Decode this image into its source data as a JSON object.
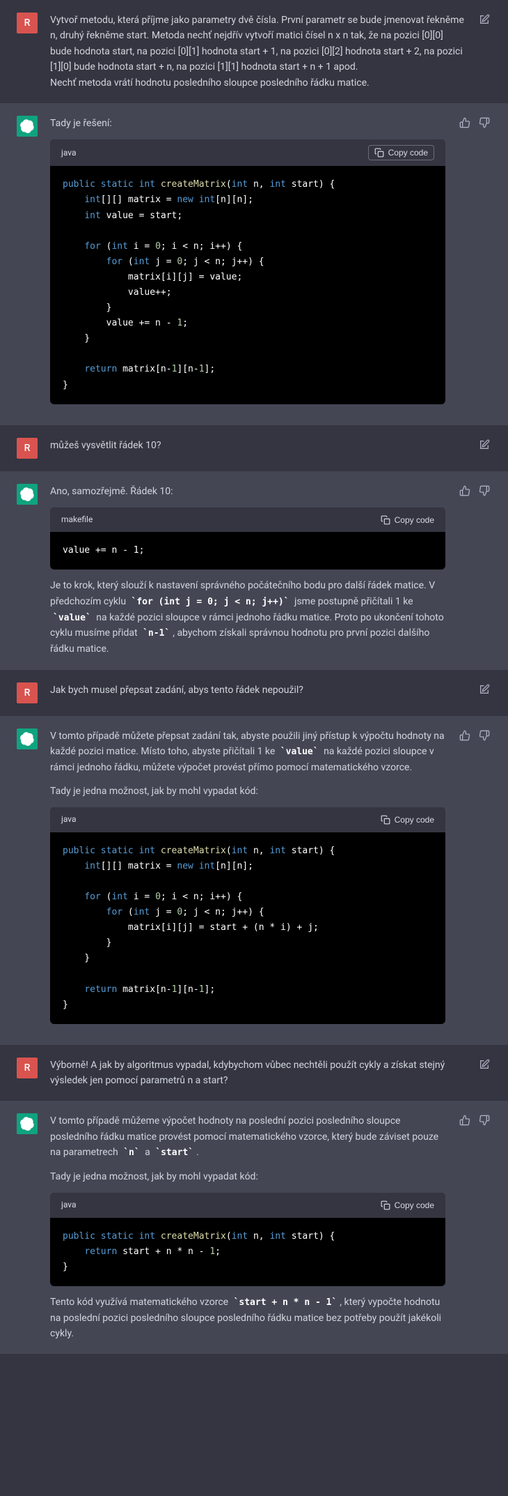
{
  "messages": [
    {
      "role": "user",
      "avatar": "R",
      "text": "Vytvoř metodu, která příjme jako parametry dvě čísla. První parametr se bude jmenovat řekněme n, druhý řekněme start. Metoda nechť nejdřív vytvoří matici čísel n x n tak, že na pozici [0][0] bude hodnota start, na pozici [0][1] hodnota start + 1, na pozici [0][2] hodnota start + 2, na pozici [1][0] bude hodnota start + n, na pozici [1][1] hodnota start + n + 1 apod.\nNechť metoda vrátí hodnotu posledního sloupce posledního řádku matice.",
      "actions": [
        "edit"
      ]
    },
    {
      "role": "assistant",
      "intro": "Tady je řešení:",
      "actions": [
        "thumbs-up",
        "thumbs-down"
      ],
      "code": {
        "lang": "java",
        "copy_label": "Copy code",
        "boxed_copy": true
      }
    },
    {
      "role": "user",
      "avatar": "R",
      "text": "můžeš vysvětlit řádek 10?",
      "actions": [
        "edit"
      ]
    },
    {
      "role": "assistant",
      "intro": "Ano, samozřejmě. Řádek 10:",
      "actions": [
        "thumbs-up",
        "thumbs-down"
      ],
      "code": {
        "lang": "makefile",
        "copy_label": "Copy code",
        "boxed_copy": false,
        "line": "value += n - 1;"
      },
      "explanation": {
        "pre1": "Je to krok, který slouží k nastavení správného počátečního bodu pro další řádek matice. V předchozím cyklu ",
        "c1": "for (int j = 0; j < n; j++)",
        "mid1": " jsme postupně přičítali 1 ke ",
        "c2": "value",
        "mid2": " na každé pozici sloupce v rámci jednoho řádku matice. Proto po ukončení tohoto cyklu musíme přidat ",
        "c3": "n-1",
        "post1": ", abychom získali správnou hodnotu pro první pozici dalšího řádku matice."
      }
    },
    {
      "role": "user",
      "avatar": "R",
      "text": "Jak bych musel přepsat zadání, abys tento řádek nepoužil?",
      "actions": [
        "edit"
      ]
    },
    {
      "role": "assistant",
      "intro_parts": {
        "pre": "V tomto případě můžete přepsat zadání tak, abyste použili jiný přístup k výpočtu hodnoty na každé pozici matice. Místo toho, abyste přičítali 1 ke ",
        "c1": "value",
        "post": " na každé pozici sloupce v rámci jednoho řádku, můžete výpočet provést přímo pomocí matematického vzorce."
      },
      "intro2": "Tady je jedna možnost, jak by mohl vypadat kód:",
      "actions": [
        "thumbs-up",
        "thumbs-down"
      ],
      "code": {
        "lang": "java",
        "copy_label": "Copy code",
        "boxed_copy": false
      }
    },
    {
      "role": "user",
      "avatar": "R",
      "text": "Výborně! A jak by algoritmus vypadal, kdybychom vůbec nechtěli použít cykly a získat stejný výsledek jen pomocí parametrů n a start?",
      "actions": [
        "edit"
      ]
    },
    {
      "role": "assistant",
      "intro_parts": {
        "pre": "V tomto případě můžeme výpočet hodnoty na poslední pozici posledního sloupce posledního řádku matice provést pomocí matematického vzorce, který bude záviset pouze na parametrech ",
        "c1": "n",
        "mid": " a ",
        "c2": "start",
        "post": "."
      },
      "intro2": "Tady je jedna možnost, jak by mohl vypadat kód:",
      "actions": [
        "thumbs-up",
        "thumbs-down"
      ],
      "code": {
        "lang": "java",
        "copy_label": "Copy code",
        "boxed_copy": false
      },
      "outro_parts": {
        "pre": "Tento kód využívá matematického vzorce ",
        "c1": "start + n * n - 1",
        "post": ", který vypočte hodnotu na poslední pozici posledního sloupce posledního řádku matice bez potřeby použít jakékoli cykly."
      }
    }
  ]
}
